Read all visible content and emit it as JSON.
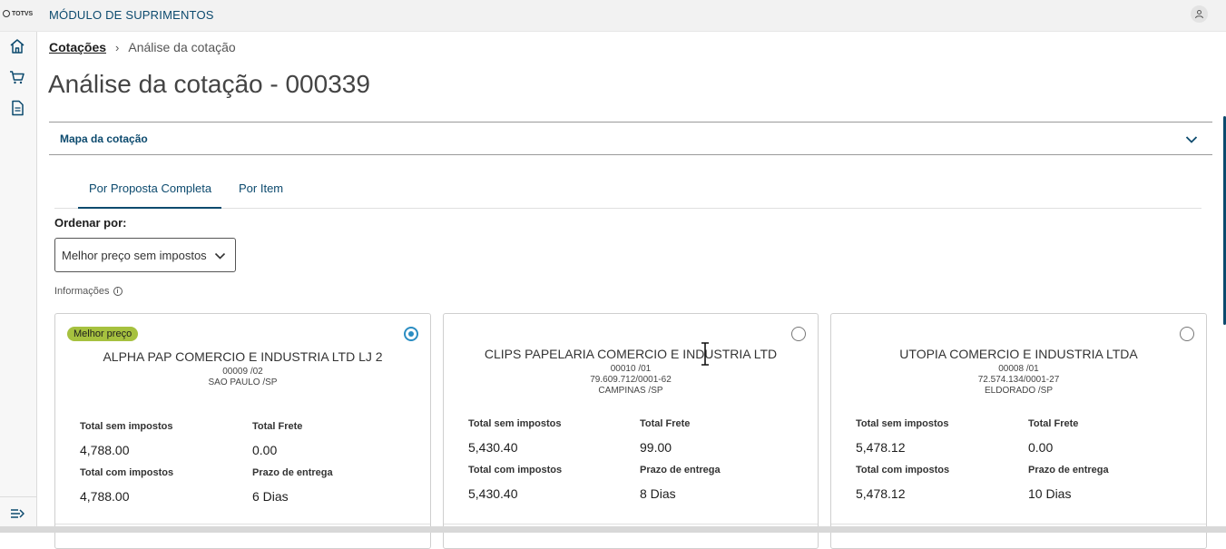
{
  "app": {
    "logo_text": "TOTVS",
    "module_title": "MÓDULO DE SUPRIMENTOS"
  },
  "sidebar": {
    "items": [
      {
        "icon": "home-icon"
      },
      {
        "icon": "cart-icon"
      },
      {
        "icon": "document-icon"
      }
    ],
    "collapse_icon": "menu-collapse-icon"
  },
  "breadcrumb": {
    "link": "Cotações",
    "current": "Análise da cotação"
  },
  "page": {
    "title": "Análise da cotação - 000339"
  },
  "accordion": {
    "label": "Mapa da cotação"
  },
  "tabs": [
    {
      "label": "Por Proposta Completa",
      "active": true
    },
    {
      "label": "Por Item",
      "active": false
    }
  ],
  "order": {
    "label": "Ordenar por:",
    "selected": "Melhor preço sem impostos"
  },
  "info": {
    "label": "Informações",
    "icon_text": "i"
  },
  "labels": {
    "total_sem": "Total sem impostos",
    "total_frete": "Total Frete",
    "total_com": "Total com impostos",
    "prazo": "Prazo de entrega"
  },
  "cards": [
    {
      "badge": "Melhor preço",
      "selected": true,
      "supplier": "ALPHA PAP COMERCIO E INDUSTRIA LTD LJ 2",
      "code": "00009 /02",
      "cnpj": "",
      "city": "SAO PAULO /SP",
      "total_sem": "4,788.00",
      "frete": "0.00",
      "total_com": "4,788.00",
      "prazo": "6 Dias"
    },
    {
      "badge": "",
      "selected": false,
      "supplier": "CLIPS PAPELARIA COMERCIO E INDUSTRIA LTD",
      "code": "00010 /01",
      "cnpj": "79.609.712/0001-62",
      "city": "CAMPINAS /SP",
      "total_sem": "5,430.40",
      "frete": "99.00",
      "total_com": "5,430.40",
      "prazo": "8 Dias"
    },
    {
      "badge": "",
      "selected": false,
      "supplier": "UTOPIA COMERCIO E INDUSTRIA LTDA",
      "code": "00008 /01",
      "cnpj": "72.574.134/0001-27",
      "city": "ELDORADO /SP",
      "total_sem": "5,478.12",
      "frete": "0.00",
      "total_com": "5,478.12",
      "prazo": "10 Dias"
    }
  ],
  "colors": {
    "primary": "#0c4a6e",
    "badge": "#a6c13f",
    "radio": "#2b8dc2"
  }
}
